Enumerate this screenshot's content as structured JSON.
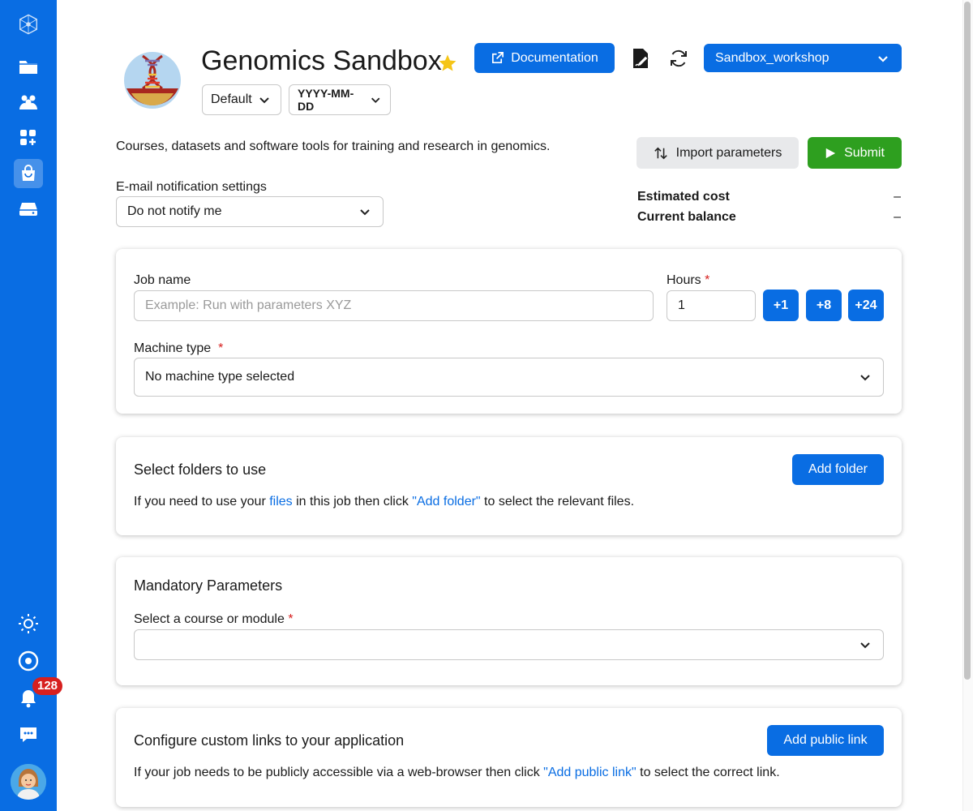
{
  "sidebar": {
    "items": [
      {
        "name": "logo-icon"
      },
      {
        "name": "files-icon"
      },
      {
        "name": "projects-icon"
      },
      {
        "name": "resources-icon"
      },
      {
        "name": "applications-icon"
      },
      {
        "name": "drives-icon"
      }
    ],
    "notification_count": "128"
  },
  "app": {
    "title": "Genomics Sandbox",
    "version": "Default",
    "date_filter": "YYYY-MM-DD",
    "documentation_label": "Documentation",
    "workspace": "Sandbox_workshop",
    "description": "Courses, datasets and software tools for training and research in genomics."
  },
  "actions": {
    "import_label": "Import parameters",
    "submit_label": "Submit"
  },
  "notifications": {
    "label": "E-mail notification settings",
    "value": "Do not notify me"
  },
  "cost": {
    "estimated_label": "Estimated cost",
    "estimated_value": "–",
    "balance_label": "Current balance",
    "balance_value": "–"
  },
  "job": {
    "name_label": "Job name",
    "name_placeholder": "Example: Run with parameters XYZ",
    "hours_label": "Hours",
    "hours_value": "1",
    "add1": "+1",
    "add8": "+8",
    "add24": "+24",
    "machine_label": "Machine type",
    "machine_value": "No machine type selected"
  },
  "folders": {
    "title": "Select folders to use",
    "button": "Add folder",
    "text_pre": "If you need to use your ",
    "text_link1": "files",
    "text_mid": " in this job then click ",
    "text_link2": "\"Add folder\"",
    "text_post": " to select the relevant files."
  },
  "mandatory": {
    "title": "Mandatory Parameters",
    "course_label": "Select a course or module",
    "course_value": ""
  },
  "links": {
    "title": "Configure custom links to your application",
    "button": "Add public link",
    "text_pre": "If your job needs to be publicly accessible via a web-browser then click ",
    "text_link": "\"Add public link\"",
    "text_post": " to select the correct link."
  },
  "colors": {
    "primary": "#096de3",
    "submit": "#2e9f1f",
    "required": "#d7201f"
  }
}
